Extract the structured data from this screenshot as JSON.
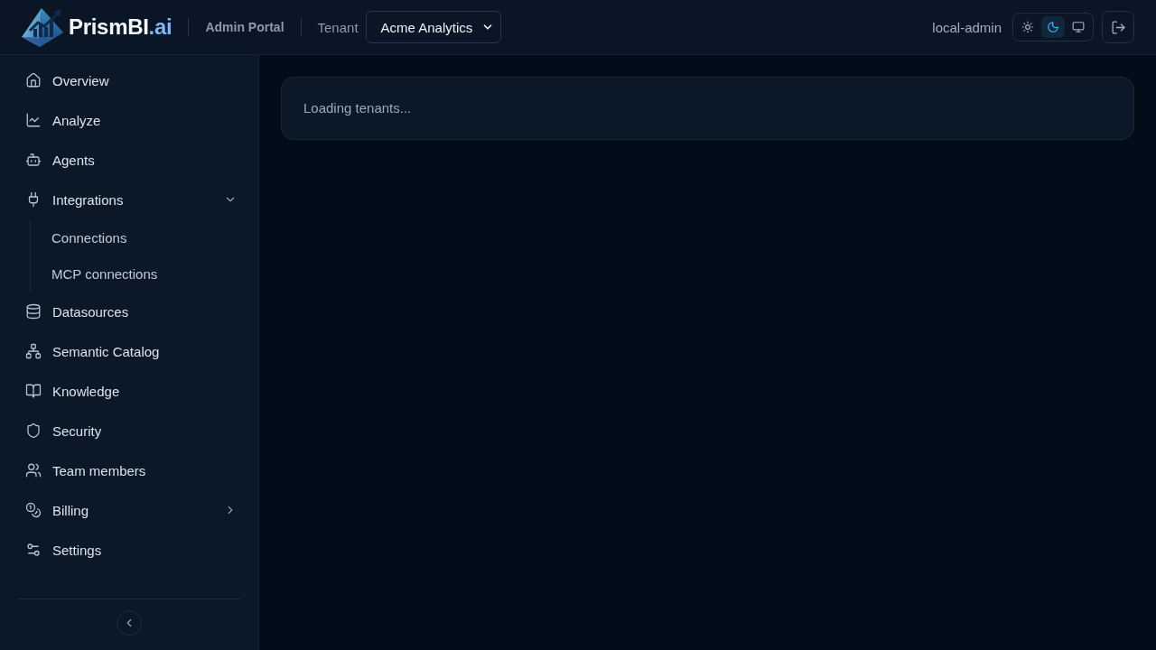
{
  "header": {
    "logo": {
      "name": "PrismBI",
      "suffix": ".ai"
    },
    "portal": "Admin Portal",
    "tenant": {
      "label": "Tenant",
      "value": "Acme Analytics"
    },
    "user": "local-admin",
    "theme_options": [
      {
        "kind": "light",
        "selected": false
      },
      {
        "kind": "dark",
        "selected": true
      },
      {
        "kind": "system",
        "selected": false
      }
    ]
  },
  "sidebar": {
    "items": [
      {
        "kind": "link",
        "label": "Overview"
      },
      {
        "kind": "link",
        "label": "Analyze"
      },
      {
        "kind": "link",
        "label": "Agents"
      },
      {
        "kind": "group",
        "label": "Integrations",
        "expanded": true,
        "children": [
          {
            "label": "Connections"
          },
          {
            "label": "MCP connections"
          }
        ]
      },
      {
        "kind": "link",
        "label": "Datasources"
      },
      {
        "kind": "link",
        "label": "Semantic Catalog"
      },
      {
        "kind": "link",
        "label": "Knowledge"
      },
      {
        "kind": "link",
        "label": "Security"
      },
      {
        "kind": "link",
        "label": "Team members"
      },
      {
        "kind": "group",
        "label": "Billing",
        "expanded": false
      },
      {
        "kind": "link",
        "label": "Settings"
      }
    ]
  },
  "main": {
    "status": "Loading tenants..."
  }
}
